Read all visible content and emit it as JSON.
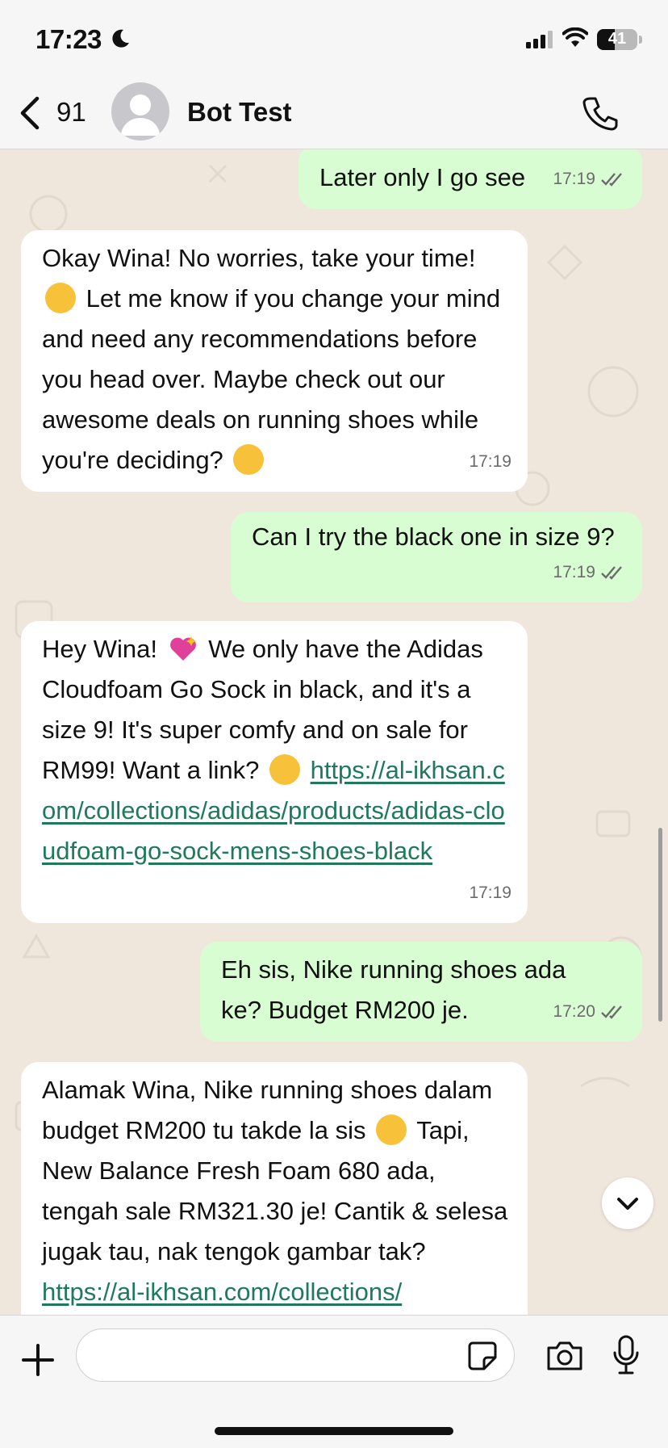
{
  "status_bar": {
    "time": "17:23",
    "battery": "41"
  },
  "header": {
    "back_count": "91",
    "contact_name": "Bot Test"
  },
  "messages": [
    {
      "dir": "out",
      "text": "Later only I go see",
      "time": "17:19"
    },
    {
      "dir": "in",
      "parts": [
        "Okay Wina!  No worries, take your time!",
        "  Let me know if you change your mind and need any recommendations before you head over.  Maybe check out our awesome deals on running shoes while you're deciding? "
      ],
      "time": "17:19"
    },
    {
      "dir": "out",
      "text": "Can I try the black one in size 9?",
      "time": "17:19"
    },
    {
      "dir": "in",
      "parts": [
        "Hey Wina! ",
        " We only have the Adidas Cloudfoam Go Sock in black, and it's a size 9!  It's super comfy and on sale for RM99!  Want a link? "
      ],
      "link": "https://al-ikhsan.com/collections/adidas/products/adidas-cloudfoam-go-sock-mens-shoes-black",
      "time": "17:19"
    },
    {
      "dir": "out",
      "text": "Eh sis, Nike running shoes ada ke? Budget RM200 je.",
      "time": "17:20"
    },
    {
      "dir": "in",
      "parts": [
        "Alamak Wina, Nike running shoes dalam budget RM200 tu takde la sis ",
        "  Tapi, New Balance Fresh Foam 680 ada, tengah sale RM321.30 je!  Cantik & selesa jugak tau, nak tengok gambar tak? "
      ],
      "link": "https://al-ikhsan.com/collections/"
    }
  ],
  "composer": {
    "placeholder": ""
  },
  "colors": {
    "outgoing_bubble": "#d9fdd3",
    "incoming_bubble": "#ffffff",
    "link": "#1f7a5a",
    "chat_bg": "#efe7dc",
    "ticks": "#6b6b6b"
  }
}
